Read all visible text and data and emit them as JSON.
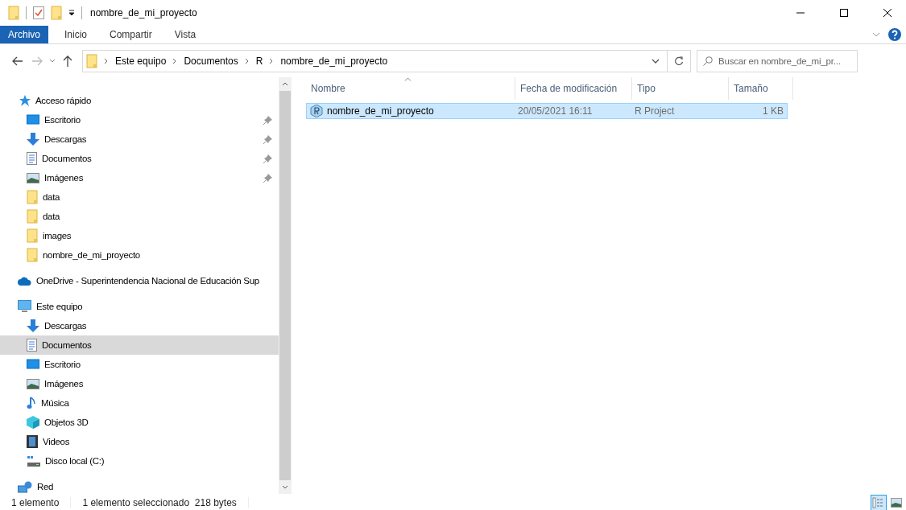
{
  "window": {
    "title": "nombre_de_mi_proyecto"
  },
  "ribbon_tabs": [
    {
      "label": "Archivo",
      "kind": "file"
    },
    {
      "label": "Inicio",
      "kind": "tab"
    },
    {
      "label": "Compartir",
      "kind": "tab"
    },
    {
      "label": "Vista",
      "kind": "tab"
    }
  ],
  "address_bar": {
    "path": [
      "Este equipo",
      "Documentos",
      "R",
      "nombre_de_mi_proyecto"
    ]
  },
  "search": {
    "placeholder": "Buscar en nombre_de_mi_pr..."
  },
  "sidebar": {
    "items": [
      {
        "label": "Acceso rápido",
        "kind": "quick",
        "selected": false,
        "children": [
          {
            "label": "Escritorio",
            "kind": "desktop",
            "pinned": true,
            "selected": false
          },
          {
            "label": "Descargas",
            "kind": "downloads",
            "pinned": true,
            "selected": false
          },
          {
            "label": "Documentos",
            "kind": "documents",
            "pinned": true,
            "selected": false
          },
          {
            "label": "Imágenes",
            "kind": "pictures",
            "pinned": true,
            "selected": false
          },
          {
            "label": "data",
            "kind": "folder",
            "pinned": false,
            "selected": false
          },
          {
            "label": "data",
            "kind": "folder",
            "pinned": false,
            "selected": false
          },
          {
            "label": "images",
            "kind": "folder",
            "pinned": false,
            "selected": false
          },
          {
            "label": "nombre_de_mi_proyecto",
            "kind": "folder",
            "pinned": false,
            "selected": false
          }
        ]
      },
      {
        "label": "OneDrive - Superintendencia Nacional de Educación Sup",
        "kind": "cloud",
        "selected": false
      },
      {
        "label": "Este equipo",
        "kind": "computer",
        "selected": false,
        "children": [
          {
            "label": "Descargas",
            "kind": "downloads",
            "pinned": false,
            "selected": false
          },
          {
            "label": "Documentos",
            "kind": "documents",
            "pinned": false,
            "selected": true
          },
          {
            "label": "Escritorio",
            "kind": "desktop",
            "pinned": false,
            "selected": false
          },
          {
            "label": "Imágenes",
            "kind": "pictures",
            "pinned": false,
            "selected": false
          },
          {
            "label": "Música",
            "kind": "music",
            "pinned": false,
            "selected": false
          },
          {
            "label": "Objetos 3D",
            "kind": "objects3d",
            "pinned": false,
            "selected": false
          },
          {
            "label": "Videos",
            "kind": "videos",
            "pinned": false,
            "selected": false
          },
          {
            "label": "Disco local (C:)",
            "kind": "drive",
            "pinned": false,
            "selected": false
          }
        ]
      },
      {
        "label": "Red",
        "kind": "network",
        "selected": false
      }
    ]
  },
  "table": {
    "columns": [
      "Nombre",
      "Fecha de modificación",
      "Tipo",
      "Tamaño"
    ],
    "rows": [
      {
        "name": "nombre_de_mi_proyecto",
        "date": "20/05/2021 16:11",
        "type": "R Project",
        "size": "1 KB",
        "selected": true
      }
    ]
  },
  "status_bar": {
    "count": "1 elemento",
    "selection": "1 elemento seleccionado  218 bytes"
  },
  "view_buttons": [
    {
      "kind": "details",
      "selected": true
    },
    {
      "kind": "thumbnails",
      "selected": false
    }
  ]
}
